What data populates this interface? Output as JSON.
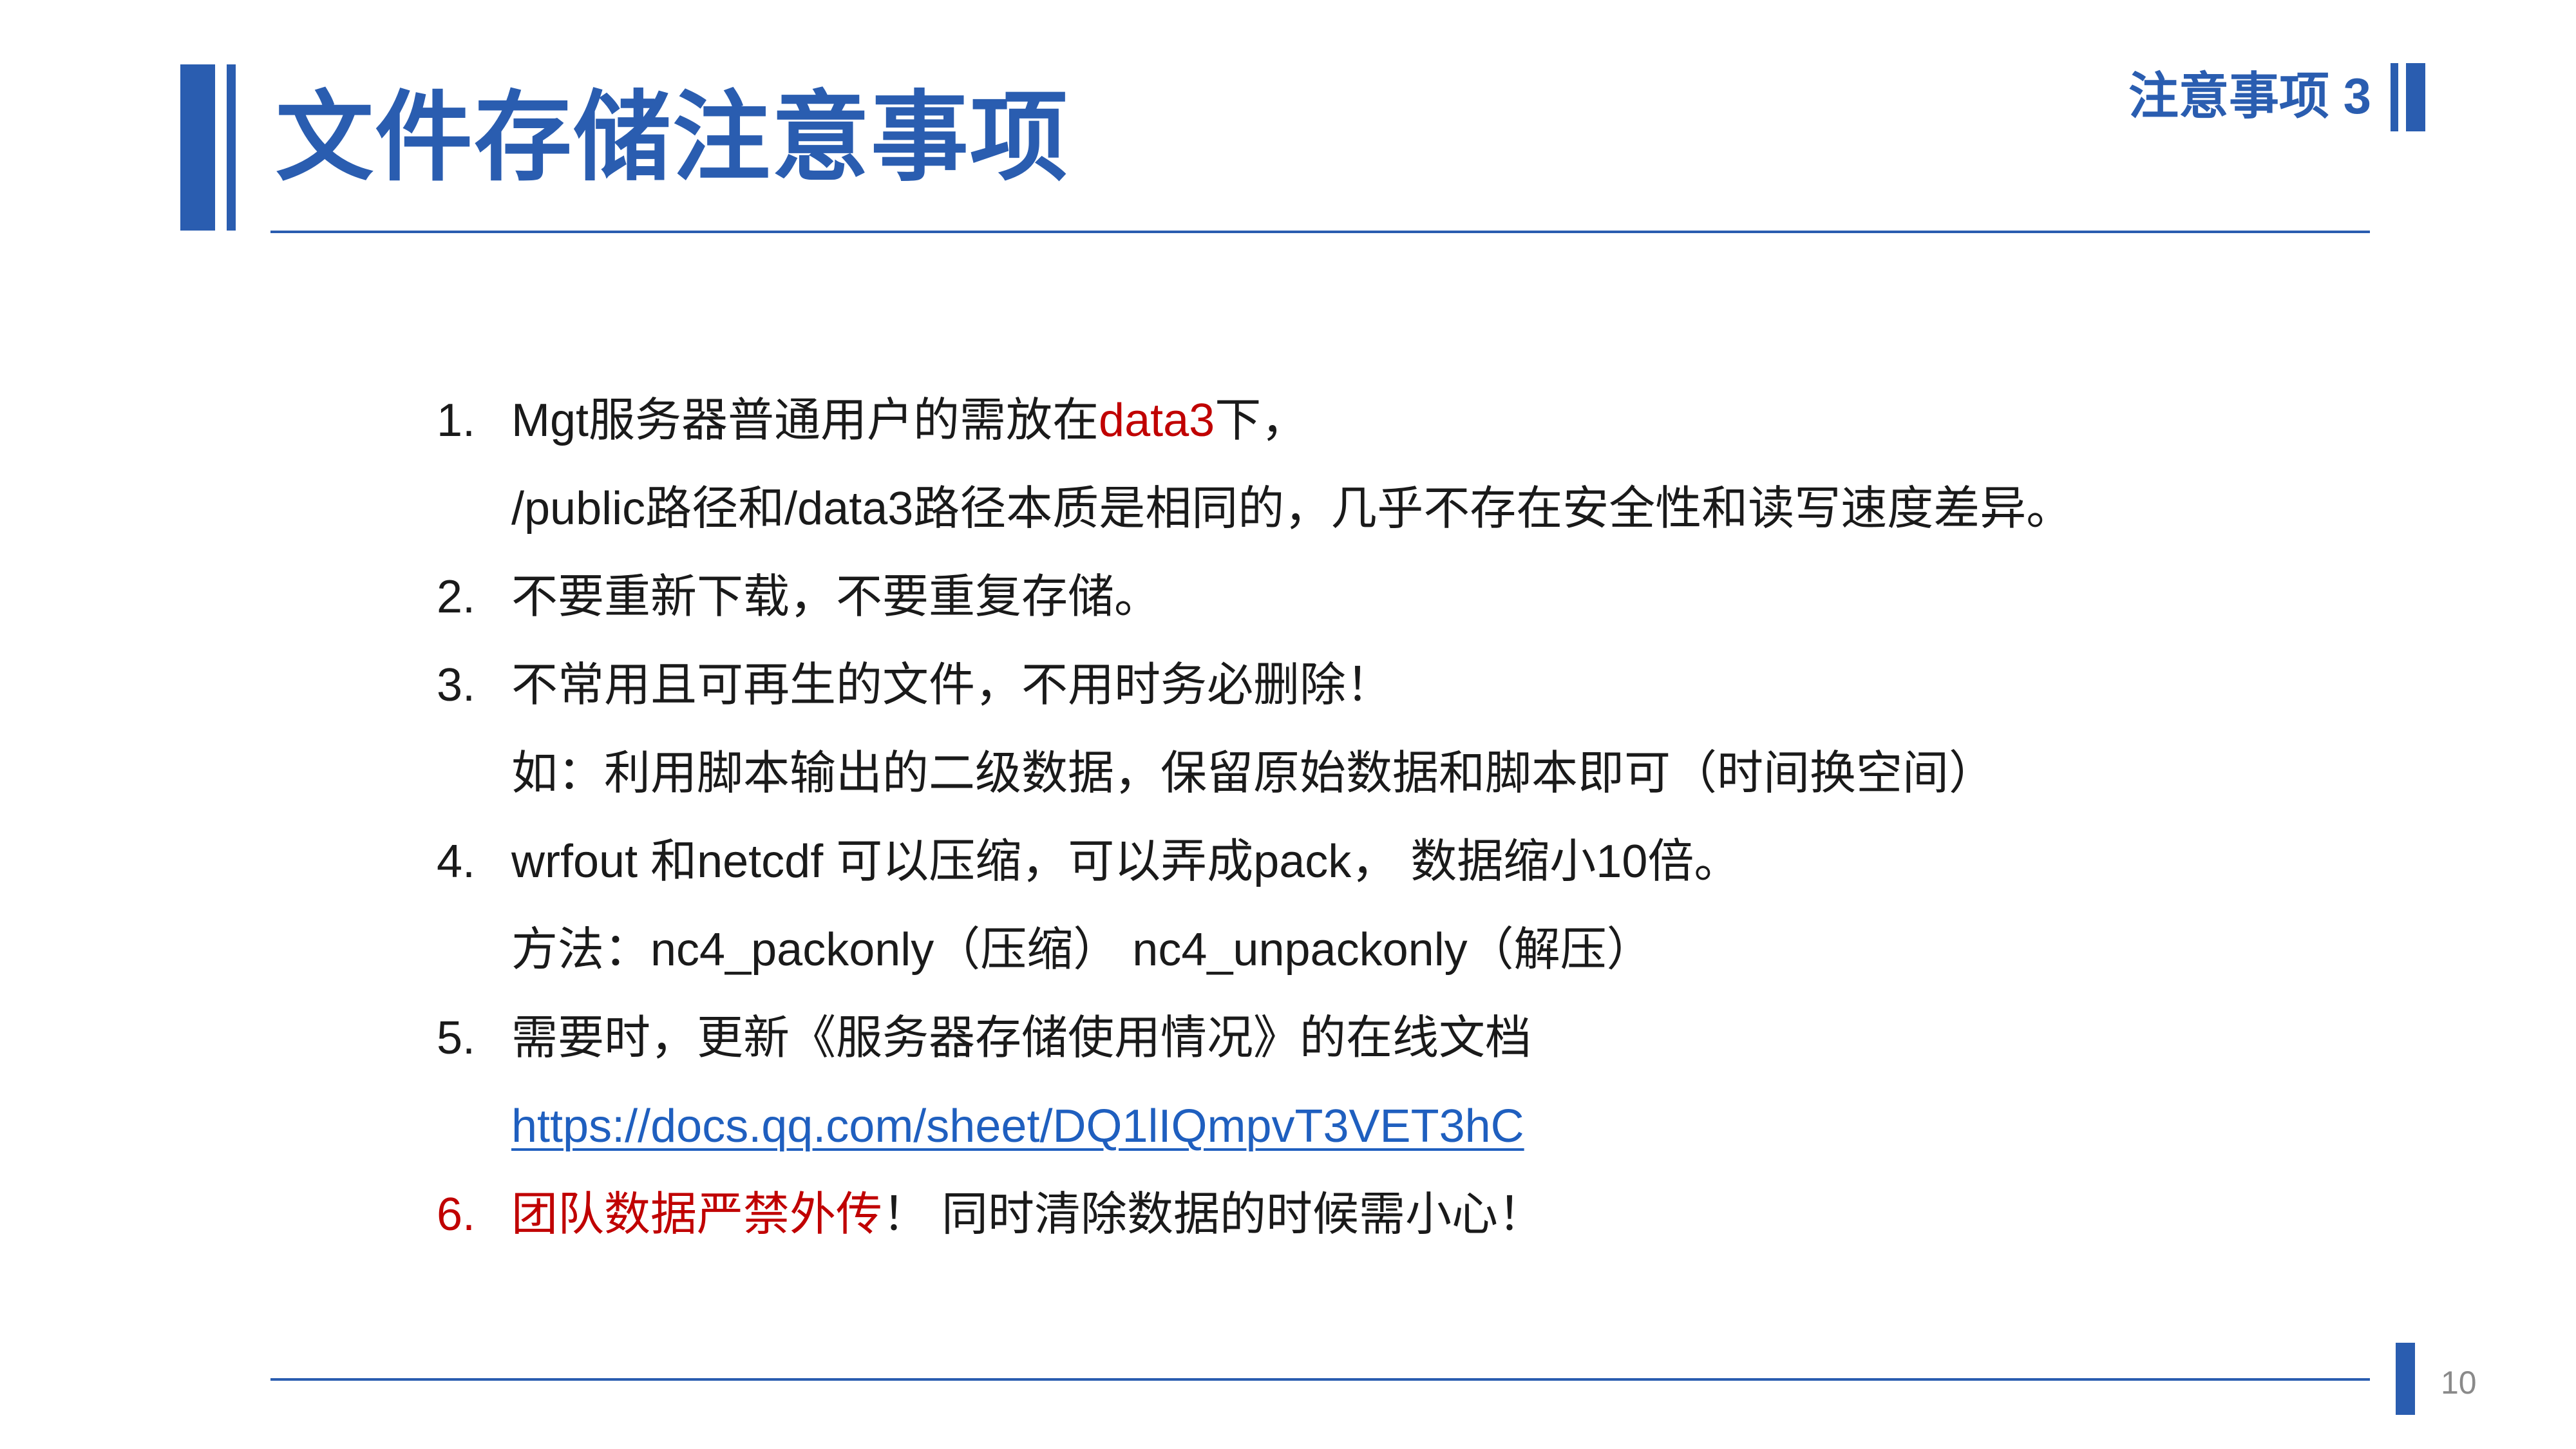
{
  "header": {
    "title": "文件存储注意事项",
    "section_label": "注意事项 3"
  },
  "items": [
    {
      "number": "1.",
      "line1_prefix": "Mgt服务器普通用户的需放在",
      "line1_highlight": "data3",
      "line1_suffix": "下，",
      "line2": "/public路径和/data3路径本质是相同的，几乎不存在安全性和读写速度差异。"
    },
    {
      "number": "2.",
      "line1": "不要重新下载，不要重复存储。"
    },
    {
      "number": "3.",
      "line1": "不常用且可再生的文件，不用时务必删除！",
      "line2": "如：利用脚本输出的二级数据，保留原始数据和脚本即可（时间换空间）"
    },
    {
      "number": "4.",
      "line1": "wrfout 和netcdf 可以压缩，可以弄成pack， 数据缩小10倍。",
      "line2": "方法：nc4_packonly（压缩） nc4_unpackonly（解压）"
    },
    {
      "number": "5.",
      "line1": "需要时，更新《服务器存储使用情况》的在线文档",
      "link": "https://docs.qq.com/sheet/DQ1lIQmpvT3VET3hC"
    },
    {
      "number": "6.",
      "line1_highlight": "团队数据严禁外传",
      "line1_suffix": "！ 同时清除数据的时候需小心！"
    }
  ],
  "footer": {
    "page_number": "10"
  },
  "colors": {
    "accent": "#2a5db0",
    "highlight": "#c00000",
    "link": "#1f5fbf",
    "text": "#1a1a1a",
    "page_number": "#8a8a8a"
  }
}
